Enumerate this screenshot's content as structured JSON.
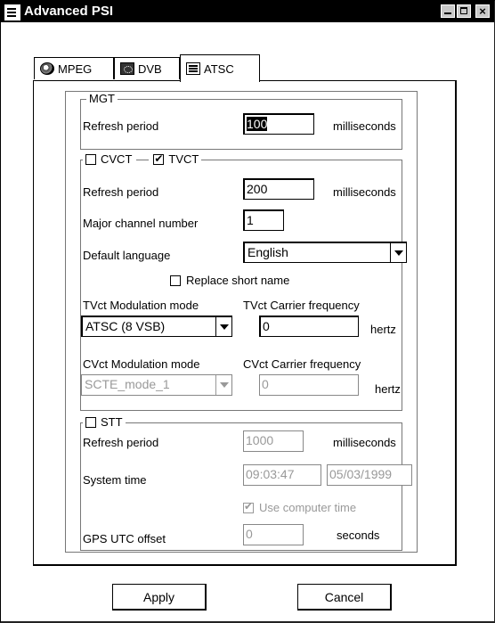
{
  "window": {
    "title": "Advanced PSI",
    "close_glyph": "×"
  },
  "tabs": [
    {
      "label": "MPEG",
      "icon": "globe-icon",
      "active": false
    },
    {
      "label": "DVB",
      "icon": "dvb-icon",
      "active": false
    },
    {
      "label": "ATSC",
      "icon": "atsc-icon",
      "active": true
    }
  ],
  "mgt": {
    "group_label": "MGT",
    "refresh_label": "Refresh period",
    "refresh_value": "100",
    "refresh_unit": "milliseconds"
  },
  "vct": {
    "cvct_label": "CVCT",
    "cvct_checked": false,
    "tvct_label": "TVCT",
    "tvct_checked": true,
    "refresh_label": "Refresh period",
    "refresh_value": "200",
    "refresh_unit": "milliseconds",
    "major_channel_label": "Major channel number",
    "major_channel_value": "1",
    "language_label": "Default language",
    "language_value": "English",
    "replace_short_name_label": "Replace short name",
    "replace_short_name_checked": false,
    "tvct_mod_label": "TVct Modulation mode",
    "tvct_mod_value": "ATSC (8 VSB)",
    "tvct_freq_label": "TVct Carrier frequency",
    "tvct_freq_value": "0",
    "tvct_freq_unit": "hertz",
    "cvct_mod_label": "CVct Modulation mode",
    "cvct_mod_value": "SCTE_mode_1",
    "cvct_freq_label": "CVct Carrier frequency",
    "cvct_freq_value": "0",
    "cvct_freq_unit": "hertz"
  },
  "stt": {
    "label": "STT",
    "checked": false,
    "refresh_label": "Refresh period",
    "refresh_value": "1000",
    "refresh_unit": "milliseconds",
    "system_time_label": "System time",
    "time_value": "09:03:47",
    "date_value": "05/03/1999",
    "use_computer_time_label": "Use computer time",
    "use_computer_time_checked": true,
    "gps_label": "GPS UTC offset",
    "gps_value": "0",
    "gps_unit": "seconds"
  },
  "buttons": {
    "apply": "Apply",
    "cancel": "Cancel"
  }
}
